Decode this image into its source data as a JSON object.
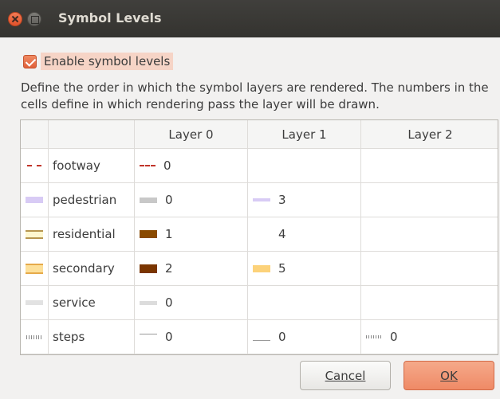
{
  "window": {
    "title": "Symbol Levels"
  },
  "enable_checkbox": {
    "label": "Enable symbol levels",
    "checked": true
  },
  "description": "Define the order in which the symbol layers are rendered. The numbers in the cells define in which rendering pass the layer will be drawn.",
  "columns": [
    "",
    "",
    "Layer 0",
    "Layer 1",
    "Layer 2"
  ],
  "rows": [
    {
      "name": "footway",
      "icon": "footway-symbol-icon",
      "layers": [
        {
          "value": "0",
          "symbol": "dotted-line-icon"
        },
        null,
        null
      ]
    },
    {
      "name": "pedestrian",
      "icon": "pedestrian-symbol-icon",
      "layers": [
        {
          "value": "0",
          "symbol": "gray-line-icon"
        },
        {
          "value": "3",
          "symbol": "lilac-line-icon"
        },
        null
      ]
    },
    {
      "name": "residential",
      "icon": "residential-symbol-icon",
      "layers": [
        {
          "value": "1",
          "symbol": "brown-line-icon"
        },
        {
          "value": "4",
          "symbol": "blank-icon"
        },
        null
      ]
    },
    {
      "name": "secondary",
      "icon": "secondary-symbol-icon",
      "layers": [
        {
          "value": "2",
          "symbol": "brown-line-icon"
        },
        {
          "value": "5",
          "symbol": "yellow-line-icon"
        },
        null
      ]
    },
    {
      "name": "service",
      "icon": "service-symbol-icon",
      "layers": [
        {
          "value": "0",
          "symbol": "light-gray-line-icon"
        },
        null,
        null
      ]
    },
    {
      "name": "steps",
      "icon": "steps-symbol-icon",
      "layers": [
        {
          "value": "0",
          "symbol": "thin-line-icon"
        },
        {
          "value": "0",
          "symbol": "thin-line-icon"
        },
        {
          "value": "0",
          "symbol": "steps-pattern-icon"
        }
      ]
    }
  ],
  "colors": {
    "footway": "#c1352a",
    "pedestrian": "#d8cbf5",
    "residential_outer": "#b79650",
    "residential_inner": "#fff7cf",
    "secondary_outer": "#e6aa4a",
    "secondary_inner": "#fde09a",
    "service": "#e2e2e2",
    "gray": "#c8c8c8",
    "brown": "#8a4a00",
    "brown2": "#7a3500",
    "yellow": "#fcd27a",
    "lilac": "#d8cbf5",
    "accent": "#e0603a"
  },
  "buttons": {
    "cancel": "Cancel",
    "ok": "OK"
  }
}
